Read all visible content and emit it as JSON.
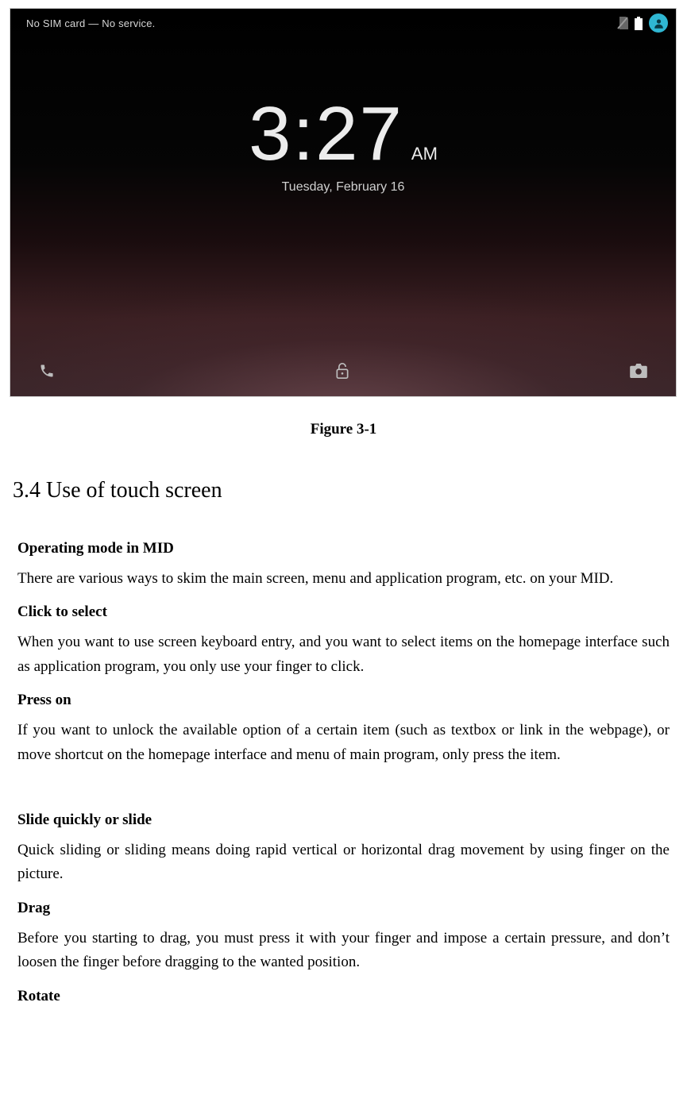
{
  "lockscreen": {
    "status_text": "No SIM card — No service.",
    "time": "3:27",
    "ampm": "AM",
    "date": "Tuesday, February 16",
    "icons": {
      "sim": "no-sim-icon",
      "battery": "battery-icon",
      "user": "user-icon",
      "phone": "phone-icon",
      "lock": "lock-icon",
      "camera": "camera-icon"
    }
  },
  "figure_caption": "Figure 3-1",
  "section": {
    "title": "3.4 Use of touch screen",
    "blocks": {
      "operating_mode_h": "Operating mode in MID",
      "operating_mode_p": "There are various ways to skim the main screen, menu and application program, etc. on your MID.",
      "click_h": "Click to select",
      "click_p": "When you want to use screen keyboard entry, and you want to select items on the homepage interface such as application program, you only use your finger to click.",
      "press_h": "Press on",
      "press_p": "If you want to unlock the available option of a certain item (such as textbox or link in the webpage), or move shortcut on the homepage interface and menu of main program, only press the item.",
      "slide_h": "Slide quickly or slide",
      "slide_p": "Quick sliding or sliding means doing rapid vertical or horizontal drag movement by using finger on the picture.",
      "drag_h": "Drag",
      "drag_p": "Before you starting to drag, you must press it with your finger and impose a certain pressure, and don’t loosen the finger before dragging to the wanted position.",
      "rotate_h": "Rotate"
    }
  }
}
